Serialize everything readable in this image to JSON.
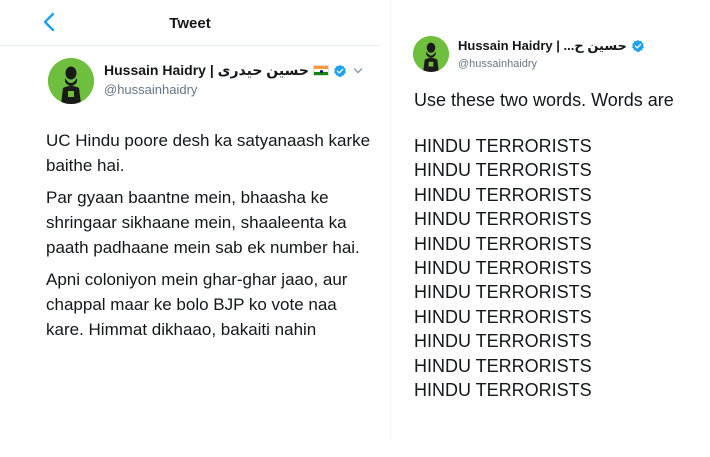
{
  "left": {
    "header_title": "Tweet",
    "author": {
      "display_name": "Hussain Haidry | حسین حیدری",
      "handle": "@hussainhaidry"
    },
    "paragraphs": [
      "UC Hindu poore desh ka satyanaash karke baithe hai.",
      "Par gyaan baantne mein, bhaasha ke shringaar sikhaane mein, shaaleenta ka paath padhaane mein sab ek number hai.",
      "Apni coloniyon mein ghar-ghar jaao, aur chappal maar ke bolo BJP ko vote naa kare. Himmat dikhaao, bakaiti nahin"
    ]
  },
  "right": {
    "author": {
      "display_name": "Hussain Haidry | ...حسین ح",
      "handle": "@hussainhaidry"
    },
    "intro_text": "Use these two words. Words are",
    "repeated_lines": [
      "HINDU TERRORISTS",
      "HINDU TERRORISTS",
      "HINDU TERRORISTS",
      "HINDU TERRORISTS",
      "HINDU TERRORISTS",
      "HINDU TERRORISTS",
      "HINDU TERRORISTS",
      "HINDU TERRORISTS",
      "HINDU TERRORISTS",
      "HINDU TERRORISTS",
      "HINDU TERRORISTS"
    ]
  },
  "icons": {
    "back": "chevron-left-icon",
    "verified": "verified-badge-icon",
    "flag": "india-flag-icon",
    "more": "chevron-down-icon"
  },
  "colors": {
    "accent": "#1da1f2",
    "avatar_bg": "#6fbf3f",
    "secondary_text": "#657786",
    "primary_text": "#14171a"
  }
}
